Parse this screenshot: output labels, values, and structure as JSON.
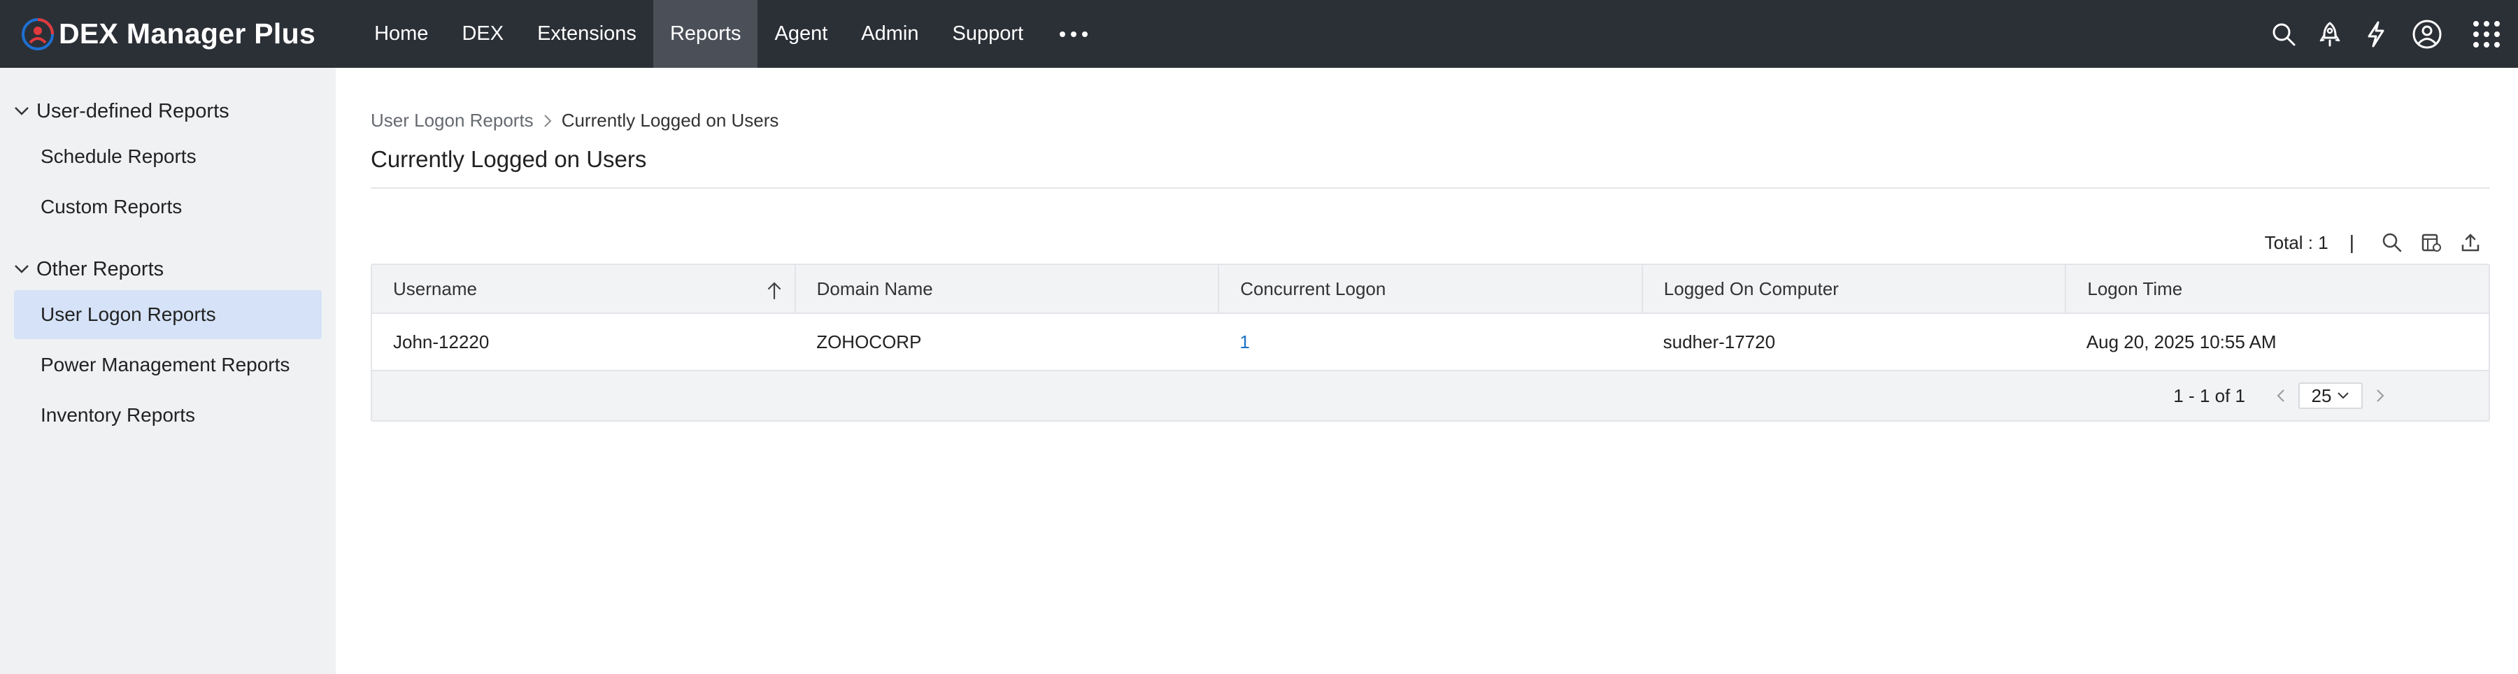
{
  "app": {
    "name": "DEX Manager Plus"
  },
  "nav": {
    "items": [
      "Home",
      "DEX",
      "Extensions",
      "Reports",
      "Agent",
      "Admin",
      "Support"
    ],
    "active": "Reports"
  },
  "top_icons": [
    "search-icon",
    "rocket-icon",
    "lightning-icon",
    "user-profile-icon",
    "app-grid-icon"
  ],
  "sidebar": {
    "groups": [
      {
        "label": "User-defined Reports",
        "items": [
          "Schedule Reports",
          "Custom Reports"
        ]
      },
      {
        "label": "Other Reports",
        "items": [
          "User Logon Reports",
          "Power Management Reports",
          "Inventory Reports"
        ]
      }
    ],
    "active_item": "User Logon Reports"
  },
  "breadcrumb": {
    "parent": "User Logon Reports",
    "current": "Currently Logged on Users"
  },
  "page": {
    "title": "Currently Logged on Users"
  },
  "toolbar": {
    "total": "Total : 1",
    "separator": "|"
  },
  "table": {
    "columns": [
      "Username",
      "Domain Name",
      "Concurrent Logon",
      "Logged On Computer",
      "Logon Time"
    ],
    "rows": [
      [
        "John-12220",
        "ZOHOCORP",
        "1",
        "sudher-17720",
        "Aug 20, 2025 10:55 AM"
      ]
    ]
  },
  "pagination": {
    "range": "1 - 1 of 1",
    "per_page": "25"
  },
  "colors": {
    "topbar": "#2b2f36",
    "active_nav": "#4a4f58",
    "sidebar": "#f0f1f3",
    "sidebar_active": "#d5e2f7",
    "link": "#1a73c8",
    "logo_red": "#e03a3e",
    "logo_blue": "#1f6fcf"
  }
}
